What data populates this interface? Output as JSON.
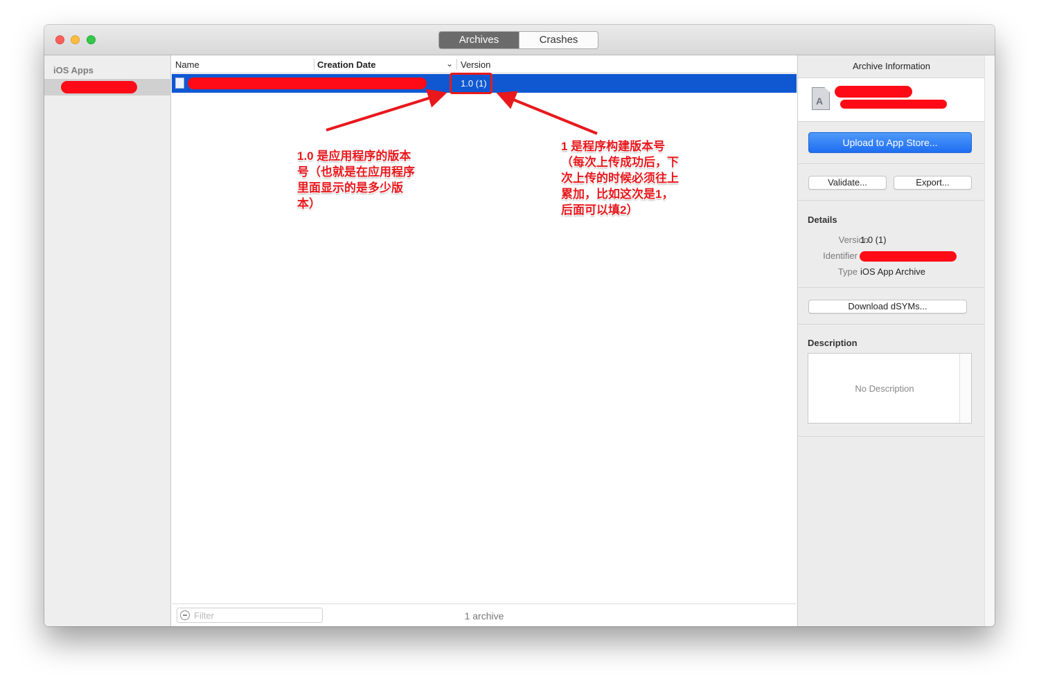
{
  "window": {
    "tabs": [
      {
        "label": "Archives",
        "active": true
      },
      {
        "label": "Crashes",
        "active": false
      }
    ]
  },
  "sidebar": {
    "header": "iOS Apps"
  },
  "list": {
    "columns": [
      "Name",
      "Creation Date",
      "Version"
    ],
    "rows": [
      {
        "version": "1.0 (1)"
      }
    ],
    "filter_placeholder": "Filter",
    "archive_count": "1 archive"
  },
  "inspector": {
    "title": "Archive Information",
    "upload_label": "Upload to App Store...",
    "validate_label": "Validate...",
    "export_label": "Export...",
    "details": {
      "heading": "Details",
      "version_label": "Version",
      "version_value": "1.0 (1)",
      "identifier_label": "Identifier",
      "type_label": "Type",
      "type_value": "iOS App Archive"
    },
    "download_label": "Download dSYMs...",
    "description": {
      "heading": "Description",
      "placeholder": "No Description"
    }
  },
  "annotations": {
    "version_note": "1.0 是应用程序的版本\n号（也就是在应用程序\n里面显示的是多少版\n本）",
    "build_note": "1 是程序构建版本号\n（每次上传成功后，下\n次上传的时候必须往上\n累加，比如这次是1，\n后面可以填2）"
  },
  "colors": {
    "selection": "#0f58d2",
    "annotation_red": "#e8181d",
    "primary_button": "#1f6ef2"
  }
}
